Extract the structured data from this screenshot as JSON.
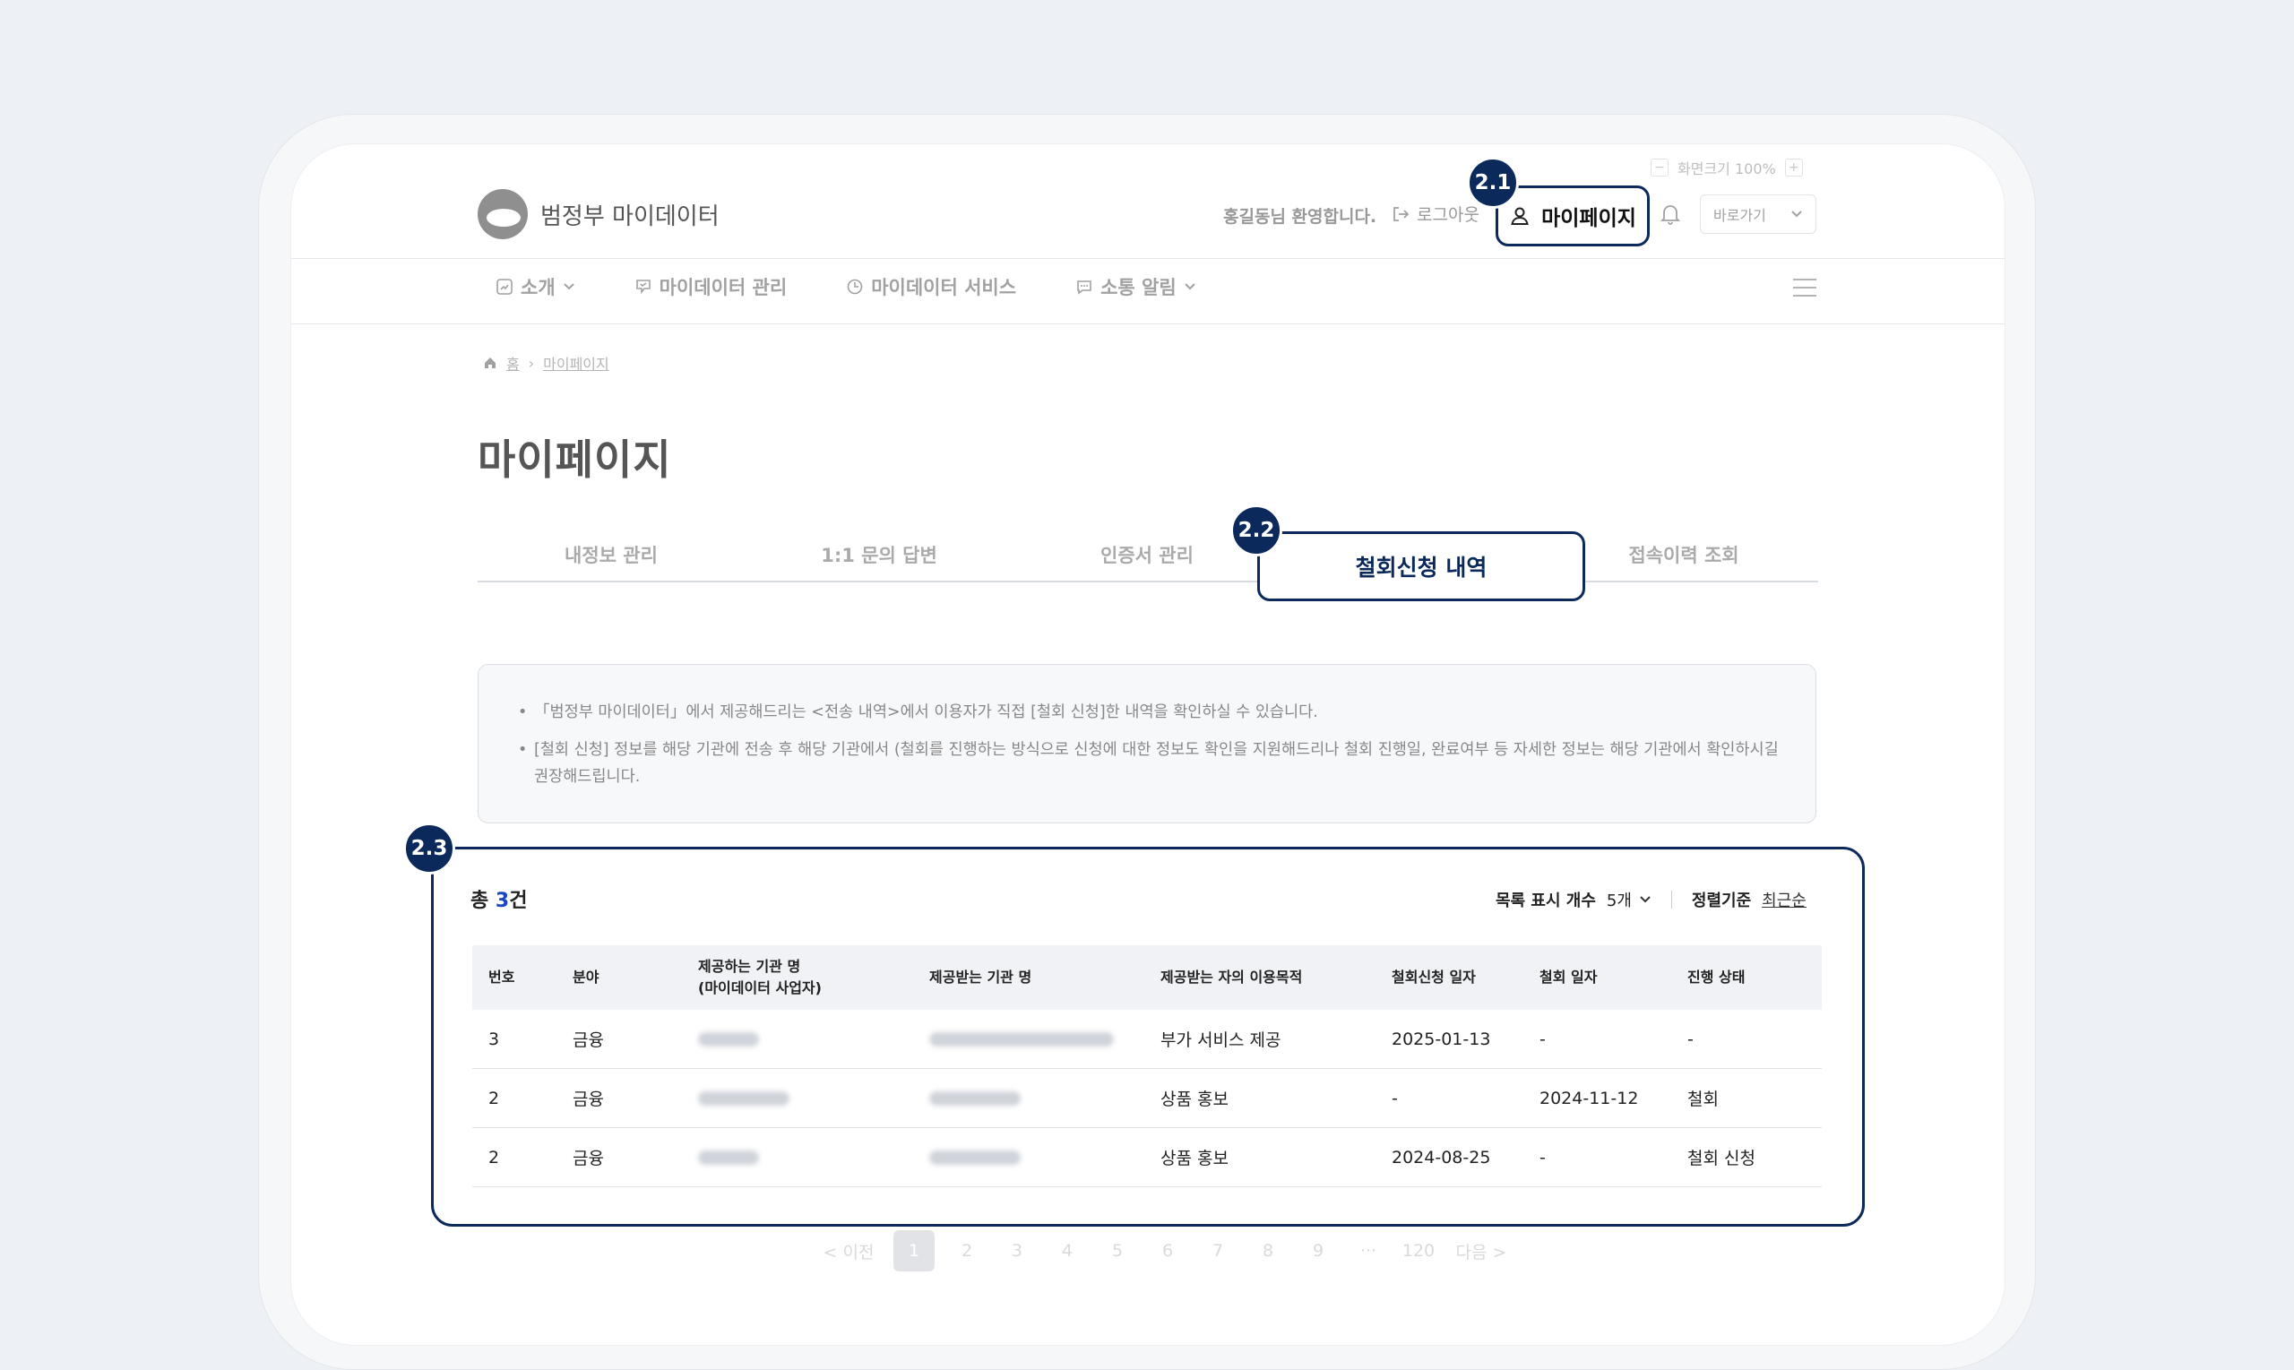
{
  "header": {
    "zoom": {
      "minus": "−",
      "label": "화면크기 100%",
      "plus": "+"
    },
    "logo_text": "범정부 마이데이터",
    "welcome": "홍길동님 환영합니다.",
    "logout": "로그아웃",
    "mypage": "마이페이지",
    "goto": "바로가기"
  },
  "nav": {
    "items": [
      {
        "label": "소개",
        "icon": "chart-doc-icon"
      },
      {
        "label": "마이데이터 관리",
        "icon": "shield-check-icon"
      },
      {
        "label": "마이데이터 서비스",
        "icon": "clock-icon"
      },
      {
        "label": "소통 알림",
        "icon": "chat-icon"
      }
    ]
  },
  "breadcrumb": {
    "home": "홈",
    "current": "마이페이지"
  },
  "page_title": "마이페이지",
  "tabs": [
    "내정보 관리",
    "1:1 문의 답변",
    "인증서 관리",
    "철회신청 내역",
    "접속이력 조회"
  ],
  "notice": [
    "「범정부 마이데이터」에서 제공해드리는 <전송 내역>에서 이용자가 직접 [철회 신청]한 내역을 확인하실 수 있습니다.",
    "[철회 신청] 정보를 해당 기관에 전송 후 해당 기관에서 (철회를 진행하는 방식으로 신청에 대한 정보도 확인을 지원해드리나 철회 진행일, 완료여부 등 자세한 정보는 해당 기관에서 확인하시길 권장해드립니다."
  ],
  "list": {
    "total_prefix": "총 ",
    "total_count": "3",
    "total_suffix": "건",
    "page_size_label": "목록 표시 개수",
    "page_size_value": "5개",
    "sort_label": "정렬기준",
    "sort_value": "최근순",
    "columns": [
      "번호",
      "분야",
      "제공하는 기관 명",
      "(마이데이터 사업자)",
      "제공받는 기관 명",
      "제공받는 자의 이용목적",
      "철회신청 일자",
      "철회 일자",
      "진행 상태"
    ],
    "rows": [
      {
        "no": "3",
        "field": "금융",
        "purpose": "부가 서비스 제공",
        "req_date": "2025-01-13",
        "wd_date": "-",
        "status": "-"
      },
      {
        "no": "2",
        "field": "금융",
        "purpose": "상품 홍보",
        "req_date": "-",
        "wd_date": "2024-11-12",
        "status": "철회"
      },
      {
        "no": "2",
        "field": "금융",
        "purpose": "상품 홍보",
        "req_date": "2024-08-25",
        "wd_date": "-",
        "status": "철회 신청"
      }
    ]
  },
  "pagination": [
    "< 이전",
    "1",
    "2",
    "3",
    "4",
    "5",
    "6",
    "7",
    "8",
    "9",
    "···",
    "120",
    "다음 >"
  ],
  "badges": [
    "2.1",
    "2.2",
    "2.3"
  ],
  "colors": {
    "highlight": "#0b2a5b",
    "accent_count": "#1a46c4"
  }
}
